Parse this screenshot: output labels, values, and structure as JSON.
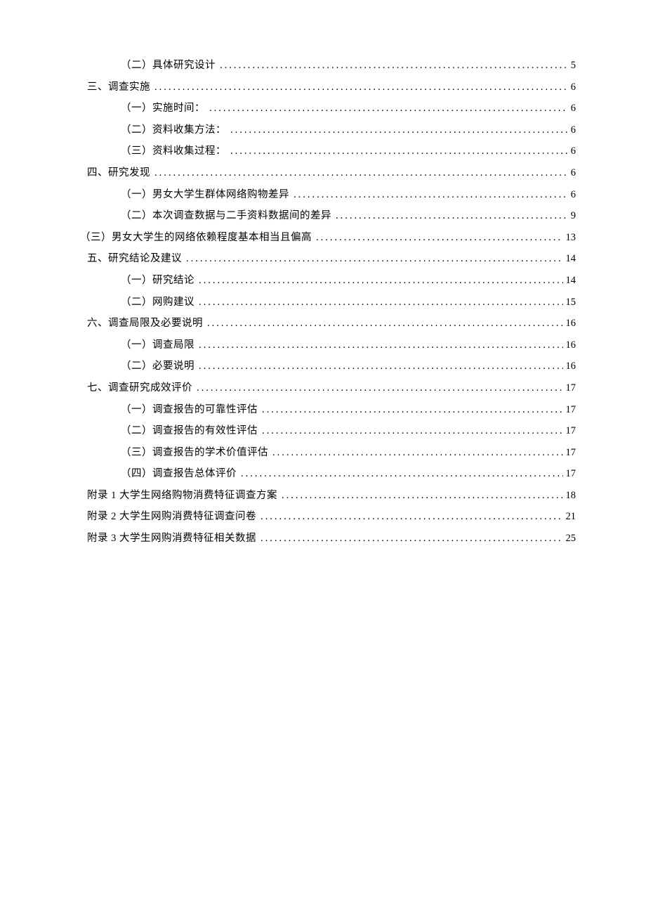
{
  "toc": [
    {
      "label": "（二）具体研究设计",
      "page": "5",
      "level": "level-2"
    },
    {
      "label": "三、调查实施",
      "page": "6",
      "level": "level-1"
    },
    {
      "label": "（一）实施时间：",
      "page": "6",
      "level": "level-2"
    },
    {
      "label": "（二）资料收集方法：",
      "page": "6",
      "level": "level-2"
    },
    {
      "label": "（三）资料收集过程：",
      "page": "6",
      "level": "level-2"
    },
    {
      "label": "四、研究发现",
      "page": "6",
      "level": "level-1"
    },
    {
      "label": "（一）男女大学生群体网络购物差异",
      "page": "6",
      "level": "level-2"
    },
    {
      "label": "（二）本次调查数据与二手资料数据间的差异",
      "page": "9",
      "level": "level-2"
    },
    {
      "label": "（三）男女大学生的网络依赖程度基本相当且偏高",
      "page": "13",
      "level": "outdent"
    },
    {
      "label": "五、研究结论及建议",
      "page": "14",
      "level": "level-1"
    },
    {
      "label": "（一）研究结论",
      "page": "14",
      "level": "level-2"
    },
    {
      "label": "（二）网购建议",
      "page": "15",
      "level": "level-2"
    },
    {
      "label": "六、调查局限及必要说明",
      "page": "16",
      "level": "level-1"
    },
    {
      "label": "（一）调查局限",
      "page": "16",
      "level": "level-2"
    },
    {
      "label": "（二）必要说明",
      "page": "16",
      "level": "level-2"
    },
    {
      "label": "七、调查研究成效评价",
      "page": "17",
      "level": "level-1"
    },
    {
      "label": "（一）调查报告的可靠性评估",
      "page": "17",
      "level": "level-2"
    },
    {
      "label": "（二）调查报告的有效性评估",
      "page": "17",
      "level": "level-2"
    },
    {
      "label": "（三）调查报告的学术价值评估",
      "page": "17",
      "level": "level-2"
    },
    {
      "label": "（四）调查报告总体评价",
      "page": "17",
      "level": "level-2"
    },
    {
      "label": "附录 1 大学生网络购物消费特征调查方案",
      "page": "18",
      "level": "level-0"
    },
    {
      "label": "附录 2 大学生网购消费特征调查问卷",
      "page": "21",
      "level": "level-0"
    },
    {
      "label": "附录 3 大学生网购消费特征相关数据",
      "page": "25",
      "level": "level-0"
    }
  ]
}
